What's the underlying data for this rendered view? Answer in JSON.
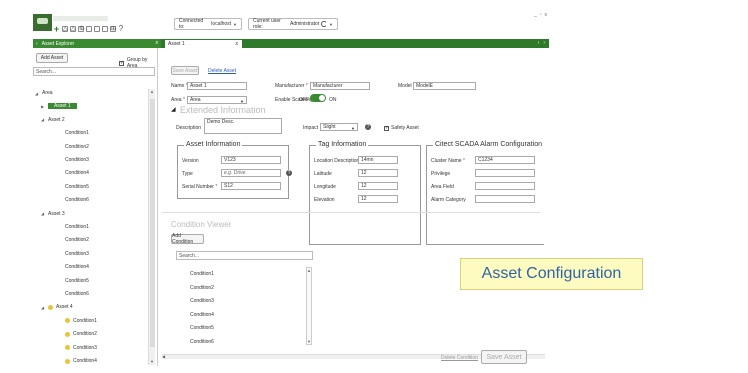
{
  "toolbar": {
    "connected_label": "Connected to:",
    "connected_value": "localhost",
    "role_label": "Current user role:",
    "role_value": "Administrator",
    "window_controls": [
      "_",
      "▫",
      "x"
    ]
  },
  "tabs": {
    "explorer_title": "Asset Explorer",
    "document_tab": "Asset 1",
    "close_glyph": "x",
    "nav_left": "‹",
    "nav_right": "›"
  },
  "sidebar": {
    "add_asset": "Add Asset",
    "group_by_area": "Group by Area",
    "search_placeholder": "Search...",
    "tree": [
      {
        "label": "Area",
        "level": 0,
        "toggle": "◢"
      },
      {
        "label": "Asset 1",
        "level": 1,
        "toggle": "▶",
        "selected": true
      },
      {
        "label": "Asset 2",
        "level": 1,
        "toggle": "◢"
      },
      {
        "label": "Condition1",
        "level": 2
      },
      {
        "label": "Condition2",
        "level": 2
      },
      {
        "label": "Condition3",
        "level": 2
      },
      {
        "label": "Condition4",
        "level": 2
      },
      {
        "label": "Condition5",
        "level": 2
      },
      {
        "label": "Condition6",
        "level": 2
      },
      {
        "label": "Asset 3",
        "level": 1,
        "toggle": "◢"
      },
      {
        "label": "Condition1",
        "level": 2
      },
      {
        "label": "Condition2",
        "level": 2
      },
      {
        "label": "Condition3",
        "level": 2
      },
      {
        "label": "Condition4",
        "level": 2
      },
      {
        "label": "Condition5",
        "level": 2
      },
      {
        "label": "Condition6",
        "level": 2
      },
      {
        "label": "Asset 4",
        "level": 1,
        "toggle": "◢",
        "warn": true
      },
      {
        "label": "Condition1",
        "level": 2,
        "warn": true
      },
      {
        "label": "Condition2",
        "level": 2,
        "warn": true
      },
      {
        "label": "Condition3",
        "level": 2,
        "warn": true
      },
      {
        "label": "Condition4",
        "level": 2,
        "warn": true
      }
    ]
  },
  "form": {
    "save_asset_top": "Save Asset",
    "delete_asset": "Delete Asset",
    "name_label": "Name",
    "name_value": "Asset 1",
    "manufacturer_label": "Manufacturer",
    "manufacturer_value": "Manufacturer",
    "model_label": "Model",
    "model_value": "ModelE",
    "area_label": "Area",
    "area_value": "Area",
    "scanning_label": "Enable Scanning",
    "scanning_off": "OFF",
    "scanning_on": "ON",
    "extended_header": "Extended Information",
    "description_label": "Description",
    "description_value": "Demo Desc.",
    "impact_label": "Impact",
    "impact_value": "Slight",
    "safety_label": "Safety Asset"
  },
  "asset_info": {
    "title": "Asset Information",
    "version_label": "Version",
    "version_value": "V123",
    "type_label": "Type",
    "type_placeholder": "e.g. Drive",
    "serial_label": "Serial Number",
    "serial_value": "S12"
  },
  "tag_info": {
    "title": "Tag Information",
    "location_label": "Location Description",
    "location_value": "14mn",
    "latitude_label": "Latitude",
    "latitude_value": "12",
    "longitude_label": "Longitude",
    "longitude_value": "12",
    "elevation_label": "Elevation",
    "elevation_value": "12"
  },
  "alarm_config": {
    "title": "Citect SCADA Alarm Configuration",
    "cluster_label": "Cluster Name",
    "cluster_value": "C1234",
    "privilege_label": "Privilege",
    "area_label": "Area Field",
    "category_label": "Alarm Category"
  },
  "condition_viewer": {
    "header": "Condition Viewer",
    "add_condition": "Add Condition",
    "search_placeholder": "Search...",
    "items": [
      "Condition1",
      "Condition2",
      "Condition3",
      "Condition4",
      "Condition5",
      "Condition6"
    ]
  },
  "footer": {
    "delete_condition": "Delete Condition",
    "save_asset": "Save Asset"
  },
  "callout": "Asset Configuration"
}
